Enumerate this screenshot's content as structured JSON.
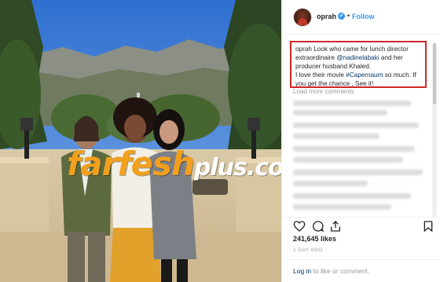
{
  "post": {
    "username": "oprah",
    "verified_icon": "✔",
    "separator": "•",
    "follow_label": "Follow",
    "caption": {
      "username": "oprah",
      "text_1": " Look who came for lunch director extraordinaire ",
      "mention": "@nadinelabaki",
      "text_2": " and her producer husband Khaled.",
      "text_3": "I love their movie ",
      "hashtag": "#Capernaum",
      "text_4": " so much. If you get the chance , See it!"
    },
    "load_more_label": "Load more comments",
    "likes": "241,645 likes",
    "time_ago": "1 DAY AGO",
    "login": {
      "login_link": "Log in",
      "rest": " to like or comment."
    }
  },
  "watermark": {
    "part1": "farfesh",
    "part2": "plus.com"
  },
  "icons": [
    "heart-icon",
    "comment-icon",
    "share-icon",
    "bookmark-icon",
    "verified-badge-icon"
  ],
  "colors": {
    "link": "#003569",
    "follow": "#3897f0",
    "highlight_box": "#d0272a",
    "watermark_orange": "#f2a01e"
  }
}
